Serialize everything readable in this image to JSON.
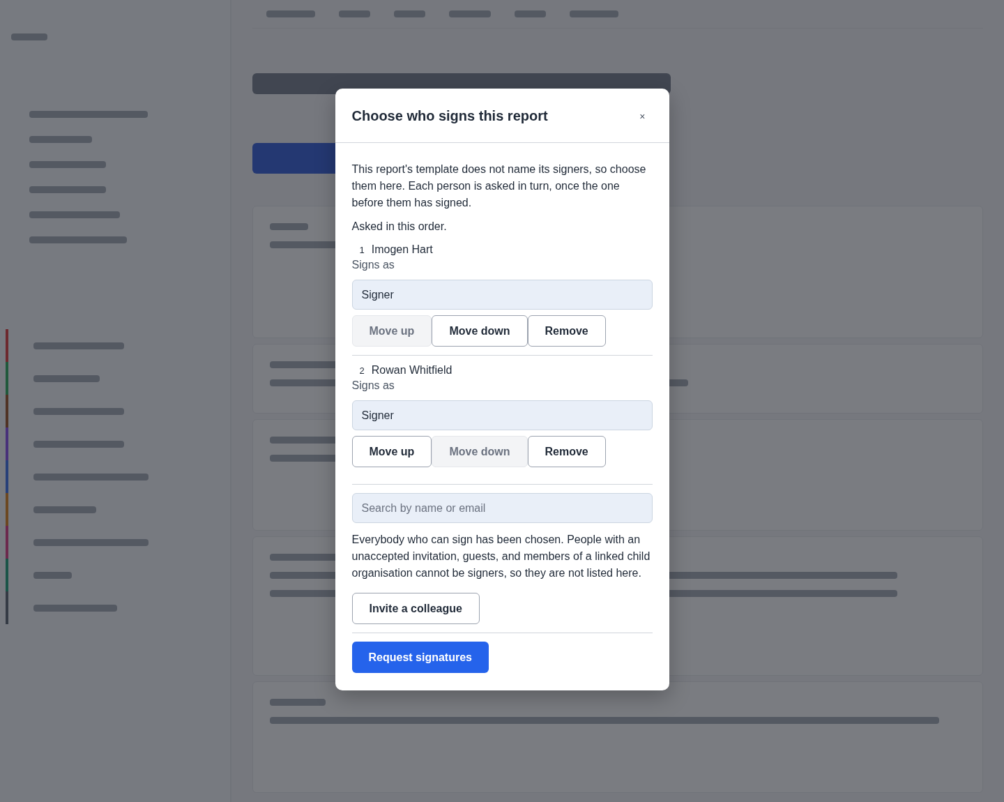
{
  "dialog": {
    "title": "Choose who signs this report",
    "close": "×",
    "intro": "This report's template does not name its signers, so choose them here. Each person is asked in turn, once the one before them has signed.",
    "order_label": "Asked in this order.",
    "signers": [
      {
        "number": "1",
        "name": "Imogen Hart",
        "role_label": "Signs as",
        "role": "Signer",
        "buttons": [
          {
            "label": "Move up",
            "disabled": true
          },
          {
            "label": "Move down",
            "disabled": false
          },
          {
            "label": "Remove",
            "disabled": false
          }
        ]
      },
      {
        "number": "2",
        "name": "Rowan Whitfield",
        "role_label": "Signs as",
        "role": "Signer",
        "buttons": [
          {
            "label": "Move up",
            "disabled": false
          },
          {
            "label": "Move down",
            "disabled": true
          },
          {
            "label": "Remove",
            "disabled": false
          }
        ]
      }
    ],
    "search": {
      "placeholder": "Search by name or email"
    },
    "note": "Everybody who can sign has been chosen. People with an unaccepted invitation, guests, and members of a linked child organisation cannot be signers, so they are not listed here.",
    "invite_button": "Invite a colleague",
    "submit_button": "Request signatures"
  }
}
